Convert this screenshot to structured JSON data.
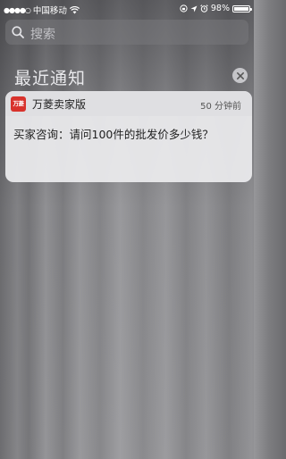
{
  "status_bar": {
    "signal": "●●●●○",
    "carrier": "中国移动",
    "wifi_icon": "wifi-icon",
    "time": "",
    "location_icon": "location-arrow-icon",
    "alarm_icon": "alarm-icon",
    "lock_rotation_icon": "orientation-lock-icon",
    "battery_percent": "98%",
    "battery_level": 0.98
  },
  "search": {
    "placeholder": "搜索",
    "icon": "search-icon"
  },
  "notifications": {
    "section_title": "最近通知",
    "clear_icon": "close-icon",
    "items": [
      {
        "app_icon_text": "万菱",
        "app_icon_color": "#d8322c",
        "app_name": "万菱卖家版",
        "time": "50 分钟前",
        "message": "买家咨询：请问100件的批发价多少钱？"
      }
    ]
  }
}
